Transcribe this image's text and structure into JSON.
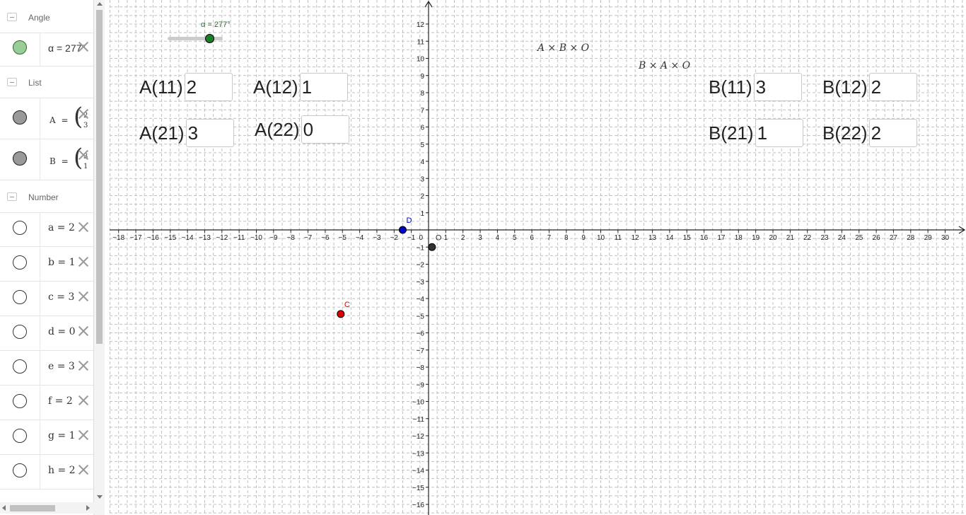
{
  "sidebar": {
    "categories": {
      "angle": "Angle",
      "list": "List",
      "number": "Number"
    },
    "angle_item": {
      "text": "α = 277°",
      "color": "#99cc99"
    },
    "list_items": [
      {
        "name": "A",
        "eq": "=",
        "cells": [
          "2",
          "3"
        ],
        "color": "#999999"
      },
      {
        "name": "B",
        "eq": "=",
        "cells": [
          "3",
          "1"
        ],
        "color": "#999999"
      }
    ],
    "number_items": [
      {
        "text": "a = 2"
      },
      {
        "text": "b = 1"
      },
      {
        "text": "c = 3"
      },
      {
        "text": "d = 0"
      },
      {
        "text": "e = 3"
      },
      {
        "text": "f = 2"
      },
      {
        "text": "g = 1"
      },
      {
        "text": "h = 2"
      }
    ]
  },
  "graphics": {
    "slider": {
      "label": "α = 277°",
      "value_deg": 277
    },
    "input_boxes": {
      "A11": {
        "label": "A(11)",
        "value": "2"
      },
      "A12": {
        "label": "A(12)",
        "value": "1"
      },
      "A21": {
        "label": "A(21)",
        "value": "3"
      },
      "A22": {
        "label": "A(22)",
        "value": "0"
      },
      "B11": {
        "label": "B(11)",
        "value": "3"
      },
      "B12": {
        "label": "B(12)",
        "value": "2"
      },
      "B21": {
        "label": "B(21)",
        "value": "1"
      },
      "B22": {
        "label": "B(22)",
        "value": "2"
      }
    },
    "expressions": {
      "abo": "A × B × O",
      "bao": "B × A × O"
    },
    "axes": {
      "x_min": -18,
      "x_max": 30,
      "y_min": -16,
      "y_max": 12,
      "grid": true
    },
    "points": [
      {
        "label": "D",
        "x": -1.5,
        "y": 0,
        "color": "#0000cc"
      },
      {
        "label": "C",
        "x": -5.1,
        "y": -4.9,
        "color": "#e00000"
      },
      {
        "label": "O",
        "x": 0.2,
        "y": -1,
        "color": "#333333"
      }
    ]
  }
}
